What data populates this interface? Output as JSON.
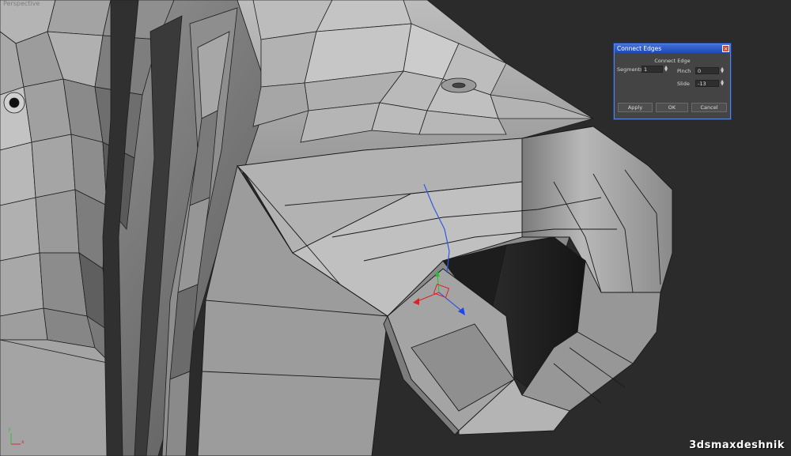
{
  "viewport": {
    "label": "Perspective",
    "watermark": "3dsmaxdeshnik",
    "gizmo": {
      "z_label": "z"
    },
    "axis_tripod": {
      "x": "x",
      "y": "y"
    },
    "colors": {
      "background": "#2b2b2b",
      "mesh_light": "#a9a9a9",
      "mesh_dark": "#3c3c3c",
      "edge_line": "#1c1c1c",
      "selected_edge": "#2d5be3"
    }
  },
  "dialog": {
    "title": "Connect Edges",
    "close_icon": "close-icon",
    "group_label": "Connect Edge",
    "segments": {
      "label": "Segments:",
      "value": "1"
    },
    "pinch": {
      "label": "Pinch",
      "value": "0"
    },
    "slide": {
      "label": "Slide",
      "value": "-13"
    },
    "buttons": {
      "apply": "Apply",
      "ok": "OK",
      "cancel": "Cancel"
    },
    "colors": {
      "title_bar": "#2a5bd0",
      "panel": "#444444",
      "border": "#5b86d6"
    }
  }
}
